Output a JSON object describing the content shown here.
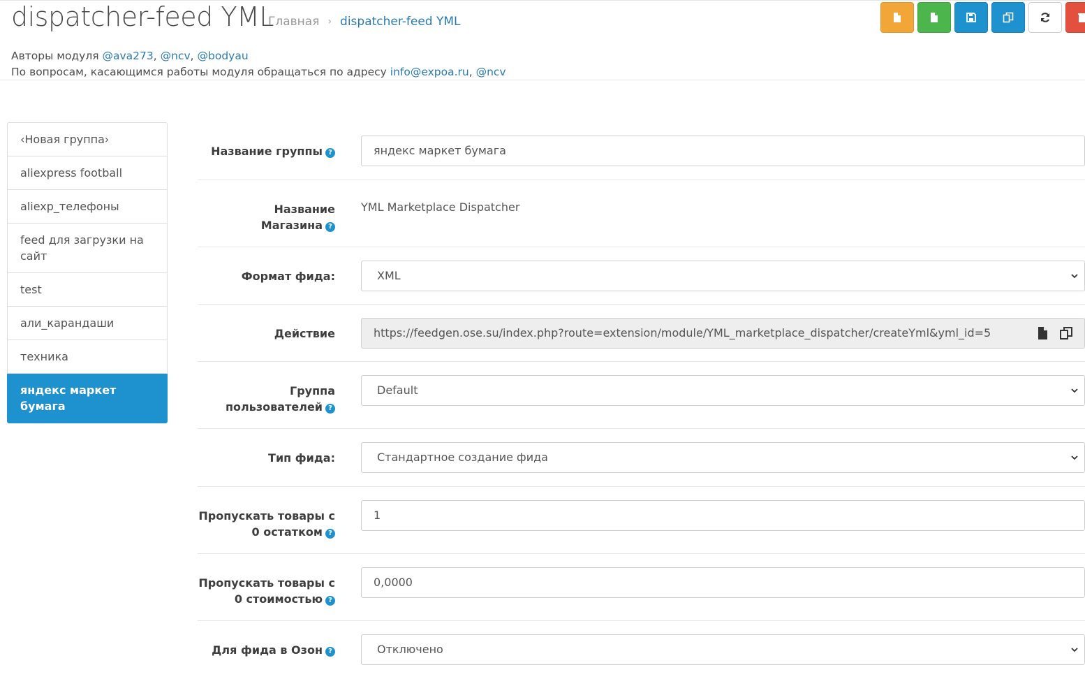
{
  "header": {
    "title": "dispatcher-feed YML",
    "breadcrumb": {
      "home": "Главная",
      "current": "dispatcher-feed YML"
    },
    "authors_prefix": "Авторы модуля",
    "authors": [
      "@ava273",
      "@ncv",
      "@bodyau"
    ],
    "contact_prefix": "По вопросам, касающимся работы модуля обращаться по адресу",
    "contact_email": "info@expoa.ru",
    "contact_user": "@ncv"
  },
  "toolbar": {
    "buttons": [
      {
        "icon": "file-icon",
        "color": "#f3a638"
      },
      {
        "icon": "file-icon",
        "color": "#4cb64c"
      },
      {
        "icon": "save-icon",
        "color": "#1e91cf"
      },
      {
        "icon": "copy-icon",
        "color": "#1e91cf"
      },
      {
        "icon": "refresh-icon",
        "color": "#ffffff"
      },
      {
        "icon": "trash-icon",
        "color": "#e3503e"
      }
    ]
  },
  "sidebar": {
    "items": [
      {
        "label": "‹Новая группа›"
      },
      {
        "label": "aliexpress football"
      },
      {
        "label": "aliexp_телефоны"
      },
      {
        "label": "feed для загрузки на сайт"
      },
      {
        "label": "test"
      },
      {
        "label": "али_карандаши"
      },
      {
        "label": "техника"
      },
      {
        "label": "яндекс маркет бумага",
        "active": true
      }
    ]
  },
  "form": {
    "group_name": {
      "label": "Название группы",
      "value": "яндекс маркет бумага"
    },
    "shop_name": {
      "label": "Название Магазина",
      "value": "YML Marketplace Dispatcher"
    },
    "feed_format": {
      "label": "Формат фида:",
      "value": "XML"
    },
    "action": {
      "label": "Действие",
      "value": "https://feedgen.ose.su/index.php?route=extension/module/YML_marketplace_dispatcher/createYml&yml_id=5"
    },
    "customer_group": {
      "label": "Группа пользователей",
      "value": "Default"
    },
    "feed_type": {
      "label": "Тип фида:",
      "value": "Стандартное создание фида"
    },
    "skip_zero_stock": {
      "label": "Пропускать товары с 0 остатком",
      "value": "1"
    },
    "skip_zero_price": {
      "label": "Пропускать товары с 0 стоимостью",
      "value": "0,0000"
    },
    "ozon_feed": {
      "label": "Для фида в Озон",
      "value": "Отключено"
    }
  }
}
